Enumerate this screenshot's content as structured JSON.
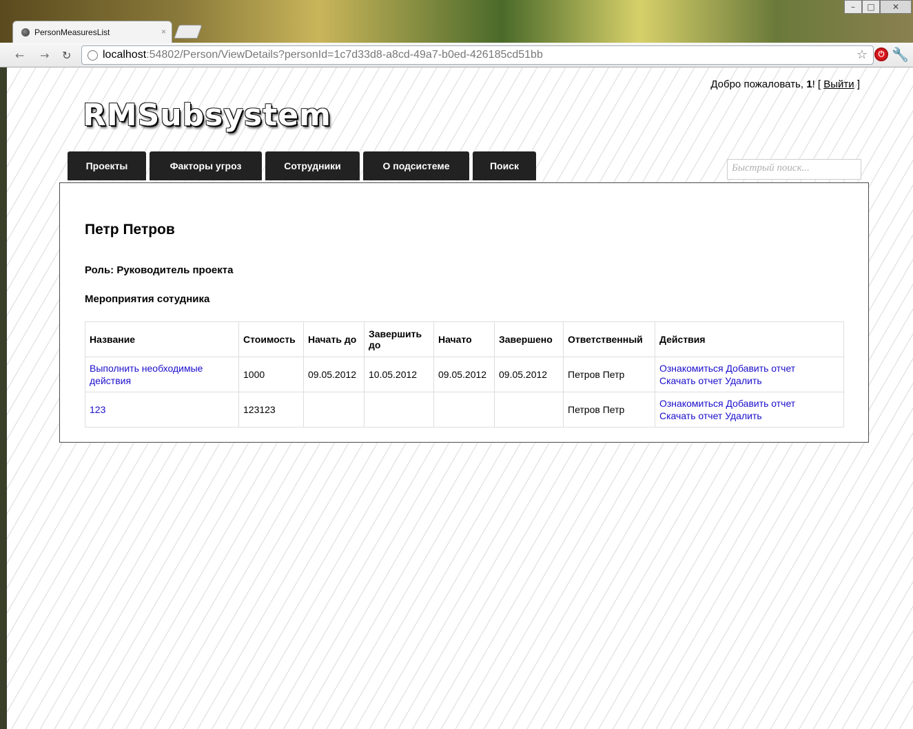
{
  "browser": {
    "tab_title": "PersonMeasuresList",
    "tab_close": "×",
    "url_host": "localhost",
    "url_rest": ":54802/Person/ViewDetails?personId=1c7d33d8-a8cd-49a7-b0ed-426185cd51bb",
    "window_controls": [
      "–",
      "□",
      "✕"
    ]
  },
  "header": {
    "welcome_text": "Добро пожаловать, ",
    "username": "1",
    "welcome_bang": "! [ ",
    "logout_label": "Выйти",
    "logout_close": " ]",
    "logo": "RMSubsystem"
  },
  "menu": {
    "items": [
      {
        "label": "Проекты"
      },
      {
        "label": "Факторы угроз"
      },
      {
        "label": "Сотрудники"
      },
      {
        "label": "О подсистеме"
      },
      {
        "label": "Поиск"
      }
    ]
  },
  "search": {
    "placeholder": "Быстрый поиск..."
  },
  "person": {
    "name": "Петр Петров",
    "role": "Роль: Руководитель проекта",
    "measures_title": "Мероприятия сотудника"
  },
  "table": {
    "headers": {
      "name": "Название",
      "cost": "Стоимость",
      "start_by": "Начать до",
      "end_by": "Завершить до",
      "started": "Начато",
      "finished": "Завершено",
      "responsible": "Ответственный",
      "actions": "Действия"
    },
    "rows": [
      {
        "name": "Выполнить необходимые действия",
        "cost": "1000",
        "start_by": "09.05.2012",
        "end_by": "10.05.2012",
        "started": "09.05.2012",
        "finished": "09.05.2012",
        "responsible": "Петров Петр",
        "action_view": "Ознакомиться",
        "action_add": "Добавить отчет",
        "action_download": "Скачать отчет",
        "action_delete": "Удалить"
      },
      {
        "name": "123",
        "cost": "123123",
        "start_by": "",
        "end_by": "",
        "started": "",
        "finished": "",
        "responsible": "Петров Петр",
        "action_view": "Ознакомиться",
        "action_add": "Добавить отчет",
        "action_download": "Скачать отчет",
        "action_delete": "Удалить"
      }
    ]
  }
}
